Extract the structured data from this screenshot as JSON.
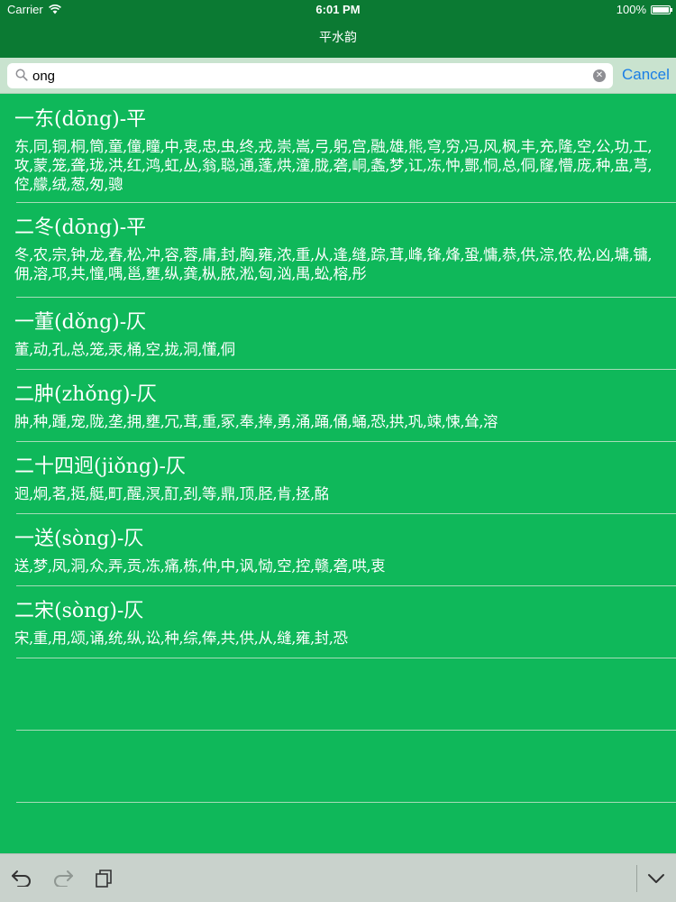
{
  "status_bar": {
    "carrier": "Carrier",
    "time": "6:01 PM",
    "battery": "100%"
  },
  "nav": {
    "title": "平水韵"
  },
  "search": {
    "value": "ong",
    "cancel_label": "Cancel"
  },
  "rhymes": [
    {
      "title": "一东(dōng)-平",
      "chars": "东,同,铜,桐,筒,童,僮,瞳,中,衷,忠,虫,终,戎,崇,嵩,弓,躬,宫,融,雄,熊,穹,穷,冯,风,枫,丰,充,隆,空,公,功,工,攻,蒙,笼,聋,珑,洪,红,鸿,虹,丛,翁,聪,通,蓬,烘,潼,胧,砻,峒,螽,梦,讧,冻,忡,酆,恫,总,侗,窿,懵,庞,种,盅,芎,倥,艨,绒,葱,匆,骢"
    },
    {
      "title": "二冬(dōng)-平",
      "chars": "冬,农,宗,钟,龙,舂,松,冲,容,蓉,庸,封,胸,雍,浓,重,从,逢,缝,踪,茸,峰,锋,烽,蛩,慵,恭,供,淙,侬,松,凶,墉,镛,佣,溶,邛,共,憧,喁,邕,壅,纵,龚,枞,脓,淞,匈,汹,禺,蚣,榕,彤"
    },
    {
      "title": "一董(dǒng)-仄",
      "chars": "董,动,孔,总,笼,汞,桶,空,拢,洞,懂,侗"
    },
    {
      "title": "二肿(zhǒng)-仄",
      "chars": "肿,种,踵,宠,陇,垄,拥,壅,冗,茸,重,冢,奉,捧,勇,涌,踊,俑,蛹,恐,拱,巩,竦,悚,耸,溶"
    },
    {
      "title": "二十四迥(jiǒng)-仄",
      "chars": "迥,炯,茗,挺,艇,町,醒,溟,酊,刭,等,鼎,顶,胫,肯,拯,酩"
    },
    {
      "title": "一送(sòng)-仄",
      "chars": "送,梦,凤,洞,众,弄,贡,冻,痛,栋,仲,中,讽,恸,空,控,赣,砻,哄,衷"
    },
    {
      "title": "二宋(sòng)-仄",
      "chars": "宋,重,用,颂,诵,统,纵,讼,种,综,俸,共,供,从,缝,雍,封,恐"
    }
  ]
}
